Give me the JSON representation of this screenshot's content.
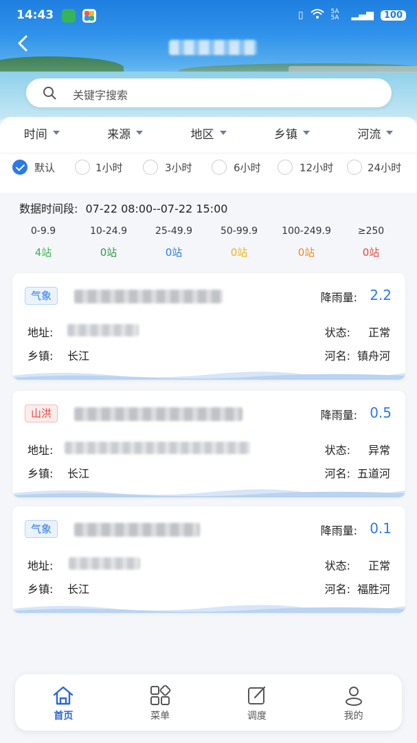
{
  "status_bar": {
    "time": "14:43",
    "network": "5A 5A",
    "battery": "100"
  },
  "search": {
    "placeholder": "关键字搜索"
  },
  "filters": [
    {
      "label": "时间"
    },
    {
      "label": "来源"
    },
    {
      "label": "地区"
    },
    {
      "label": "乡镇"
    },
    {
      "label": "河流"
    }
  ],
  "time_options": [
    {
      "label": "默认",
      "selected": true
    },
    {
      "label": "1小时",
      "selected": false
    },
    {
      "label": "3小时",
      "selected": false
    },
    {
      "label": "6小时",
      "selected": false
    },
    {
      "label": "12小时",
      "selected": false
    },
    {
      "label": "24小时",
      "selected": false
    }
  ],
  "period": {
    "label": "数据时间段:",
    "value": "07-22 08:00--07-22 15:00"
  },
  "buckets": [
    {
      "range": "0-9.9",
      "count": "4站",
      "color": "#3cb44b"
    },
    {
      "range": "10-24.9",
      "count": "0站",
      "color": "#2e9a3c"
    },
    {
      "range": "25-49.9",
      "count": "0站",
      "color": "#2a7ae8"
    },
    {
      "range": "50-99.9",
      "count": "0站",
      "color": "#f2b21b"
    },
    {
      "range": "100-249.9",
      "count": "0站",
      "color": "#f08a1c"
    },
    {
      "range": "≥250",
      "count": "0站",
      "color": "#e8453c"
    }
  ],
  "labels": {
    "rainfall": "降雨量:",
    "address": "地址:",
    "status": "状态:",
    "town": "乡镇:",
    "river": "河名:"
  },
  "stations": [
    {
      "type": "气象",
      "rainfall": "2.2",
      "status": "正常",
      "town": "长江",
      "river": "镇舟河"
    },
    {
      "type": "山洪",
      "rainfall": "0.5",
      "status": "异常",
      "town": "长江",
      "river": "五道河"
    },
    {
      "type": "气象",
      "rainfall": "0.1",
      "status": "正常",
      "town": "长江",
      "river": "福胜河"
    }
  ],
  "tabs": [
    {
      "label": "首页",
      "icon": "home-icon",
      "active": true
    },
    {
      "label": "菜单",
      "icon": "grid-icon",
      "active": false
    },
    {
      "label": "调度",
      "icon": "edit-icon",
      "active": false
    },
    {
      "label": "我的",
      "icon": "user-icon",
      "active": false
    }
  ]
}
